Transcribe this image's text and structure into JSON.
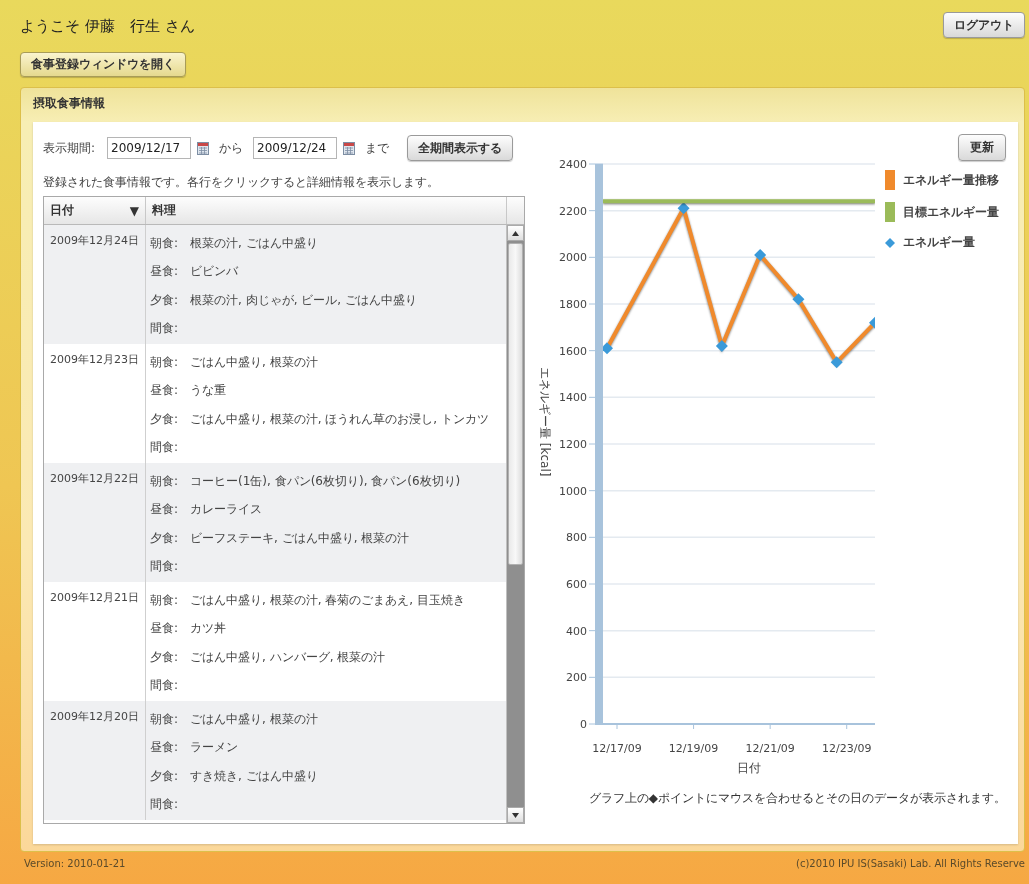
{
  "header": {
    "welcome": "ようこそ 伊藤　行生 さん",
    "logout_button": "ログアウト",
    "open_meal_window_button": "食事登録ウィンドウを開く"
  },
  "panel": {
    "title": "摂取食事情報",
    "period": {
      "label": "表示期間:",
      "from_value": "2009/12/17",
      "from_text": "から",
      "to_value": "2009/12/24",
      "to_text": "まで",
      "show_all_button": "全期間表示する"
    },
    "refresh_button": "更新",
    "description": "登録された食事情報です。各行をクリックすると詳細情報を表示します。",
    "table": {
      "columns": [
        {
          "label": "日付",
          "sort": "▼"
        },
        {
          "label": "料理"
        }
      ],
      "rows": [
        {
          "date": "2009年12月24日",
          "meals": [
            {
              "label": "朝食:",
              "items": "根菜の汁, ごはん中盛り"
            },
            {
              "label": "昼食:",
              "items": "ビビンバ"
            },
            {
              "label": "夕食:",
              "items": "根菜の汁, 肉じゃが, ビール, ごはん中盛り"
            },
            {
              "label": "間食:"
            }
          ]
        },
        {
          "date": "2009年12月23日",
          "meals": [
            {
              "label": "朝食:",
              "items": "ごはん中盛り, 根菜の汁"
            },
            {
              "label": "昼食:",
              "items": "うな重"
            },
            {
              "label": "夕食:",
              "items": "ごはん中盛り, 根菜の汁, ほうれん草のお浸し, トンカツ"
            },
            {
              "label": "間食:"
            }
          ]
        },
        {
          "date": "2009年12月22日",
          "meals": [
            {
              "label": "朝食:",
              "items": "コーヒー(1缶), 食パン(6枚切り), 食パン(6枚切り)"
            },
            {
              "label": "昼食:",
              "items": "カレーライス"
            },
            {
              "label": "夕食:",
              "items": "ビーフステーキ, ごはん中盛り, 根菜の汁"
            },
            {
              "label": "間食:"
            }
          ]
        },
        {
          "date": "2009年12月21日",
          "meals": [
            {
              "label": "朝食:",
              "items": "ごはん中盛り, 根菜の汁, 春菊のごまあえ, 目玉焼き"
            },
            {
              "label": "昼食:",
              "items": "カツ丼"
            },
            {
              "label": "夕食:",
              "items": "ごはん中盛り, ハンバーグ, 根菜の汁"
            },
            {
              "label": "間食:"
            }
          ]
        },
        {
          "date": "2009年12月20日",
          "meals": [
            {
              "label": "朝食:",
              "items": "ごはん中盛り, 根菜の汁"
            },
            {
              "label": "昼食:",
              "items": "ラーメン"
            },
            {
              "label": "夕食:",
              "items": "すき焼き, ごはん中盛り"
            },
            {
              "label": "間食:"
            }
          ]
        }
      ]
    },
    "chart": {
      "chart_data": {
        "type": "line",
        "xlabel": "日付",
        "ylabel": "エネルギー量 [kcal]",
        "categories": [
          "12/17/09",
          null,
          "12/19/09",
          null,
          "12/21/09",
          null,
          "12/23/09",
          null
        ],
        "series": [
          {
            "name": "エネルギー量推移",
            "color": "#f08a2c",
            "marker": "diamond",
            "values": [
              1610,
              null,
              2210,
              1620,
              2010,
              1820,
              1550,
              1720
            ]
          },
          {
            "name": "目標エネルギー量",
            "color": "#9bbb59",
            "values": [
              2240,
              2240,
              2240,
              2240,
              2240,
              2240,
              2240,
              2240
            ]
          }
        ],
        "grid": true,
        "ylim": [
          0,
          2400
        ],
        "yticks": [
          0,
          200,
          400,
          600,
          800,
          1000,
          1200,
          1400,
          1600,
          1800,
          2000,
          2200,
          2400
        ]
      },
      "marker_legend": {
        "label": "エネルギー量",
        "color": "#3a9ad9"
      },
      "note": "グラフ上の◆ポイントにマウスを合わせるとその日のデータが表示されます。"
    }
  },
  "footer": {
    "version": "Version: 2010-01-21",
    "copyright": "(c)2010 IPU IS(Sasaki) Lab. All Rights Reserve"
  }
}
